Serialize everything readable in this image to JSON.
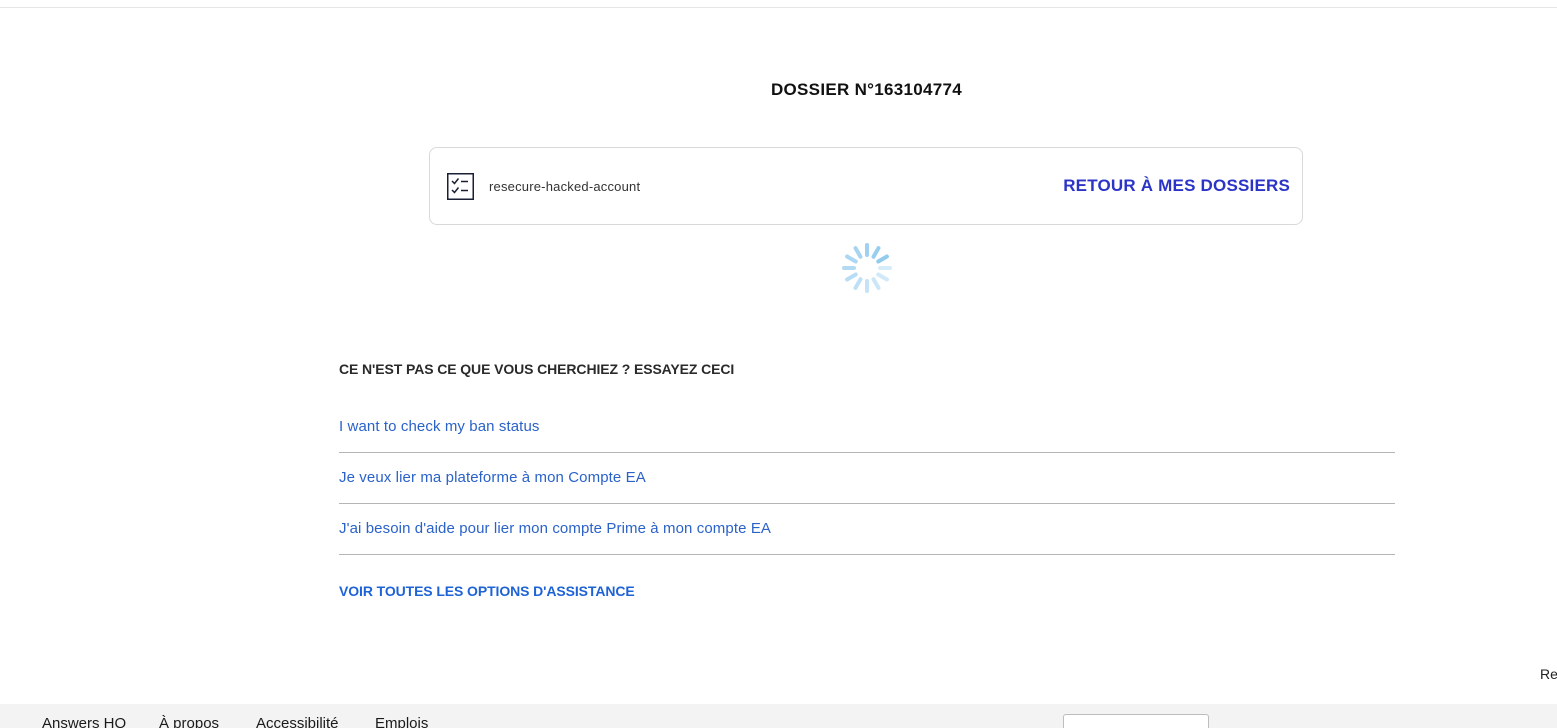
{
  "case": {
    "title": "DOSSIER N°163104774",
    "slug": "resecure-hacked-account",
    "back_link": "RETOUR À MES DOSSIERS",
    "icon": "checklist-icon"
  },
  "loading": {
    "icon": "spinner-icon",
    "color": "#8ec9ee"
  },
  "suggestions": {
    "heading": "CE N'EST PAS CE QUE VOUS CHERCHIEZ ? ESSAYEZ CECI",
    "items": [
      {
        "label": "I want to check my ban status"
      },
      {
        "label": "Je veux lier ma plateforme à mon Compte EA"
      },
      {
        "label": "J'ai besoin d'aide pour lier mon compte Prime à mon compte EA"
      }
    ],
    "all_options": "VOIR TOUTES LES OPTIONS D'ASSISTANCE"
  },
  "edge_text": "Re",
  "footer": {
    "links": [
      {
        "label": "Answers HQ"
      },
      {
        "label": "À propos"
      },
      {
        "label": "Accessibilité"
      },
      {
        "label": "Emplois"
      }
    ]
  },
  "colors": {
    "accent_dark_blue": "#2b34c6",
    "link_blue": "#2a62c9",
    "footer_bg": "#f3f3f3"
  }
}
